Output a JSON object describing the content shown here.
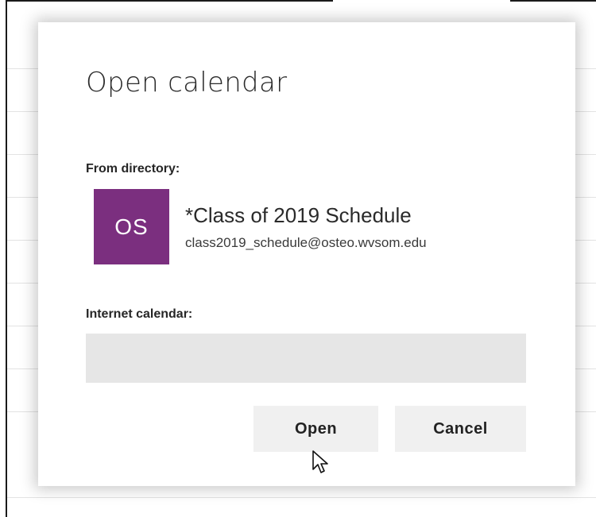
{
  "dialog": {
    "title": "Open calendar",
    "from_directory_label": "From directory:",
    "calendar": {
      "avatar_initials": "OS",
      "avatar_color": "#7b2f7f",
      "name": "*Class of 2019 Schedule",
      "email": "class2019_schedule@osteo.wvsom.edu"
    },
    "internet_calendar_label": "Internet calendar:",
    "internet_calendar_value": "",
    "open_label": "Open",
    "cancel_label": "Cancel"
  },
  "cursor": {
    "icon": "pointer-arrow-icon"
  }
}
